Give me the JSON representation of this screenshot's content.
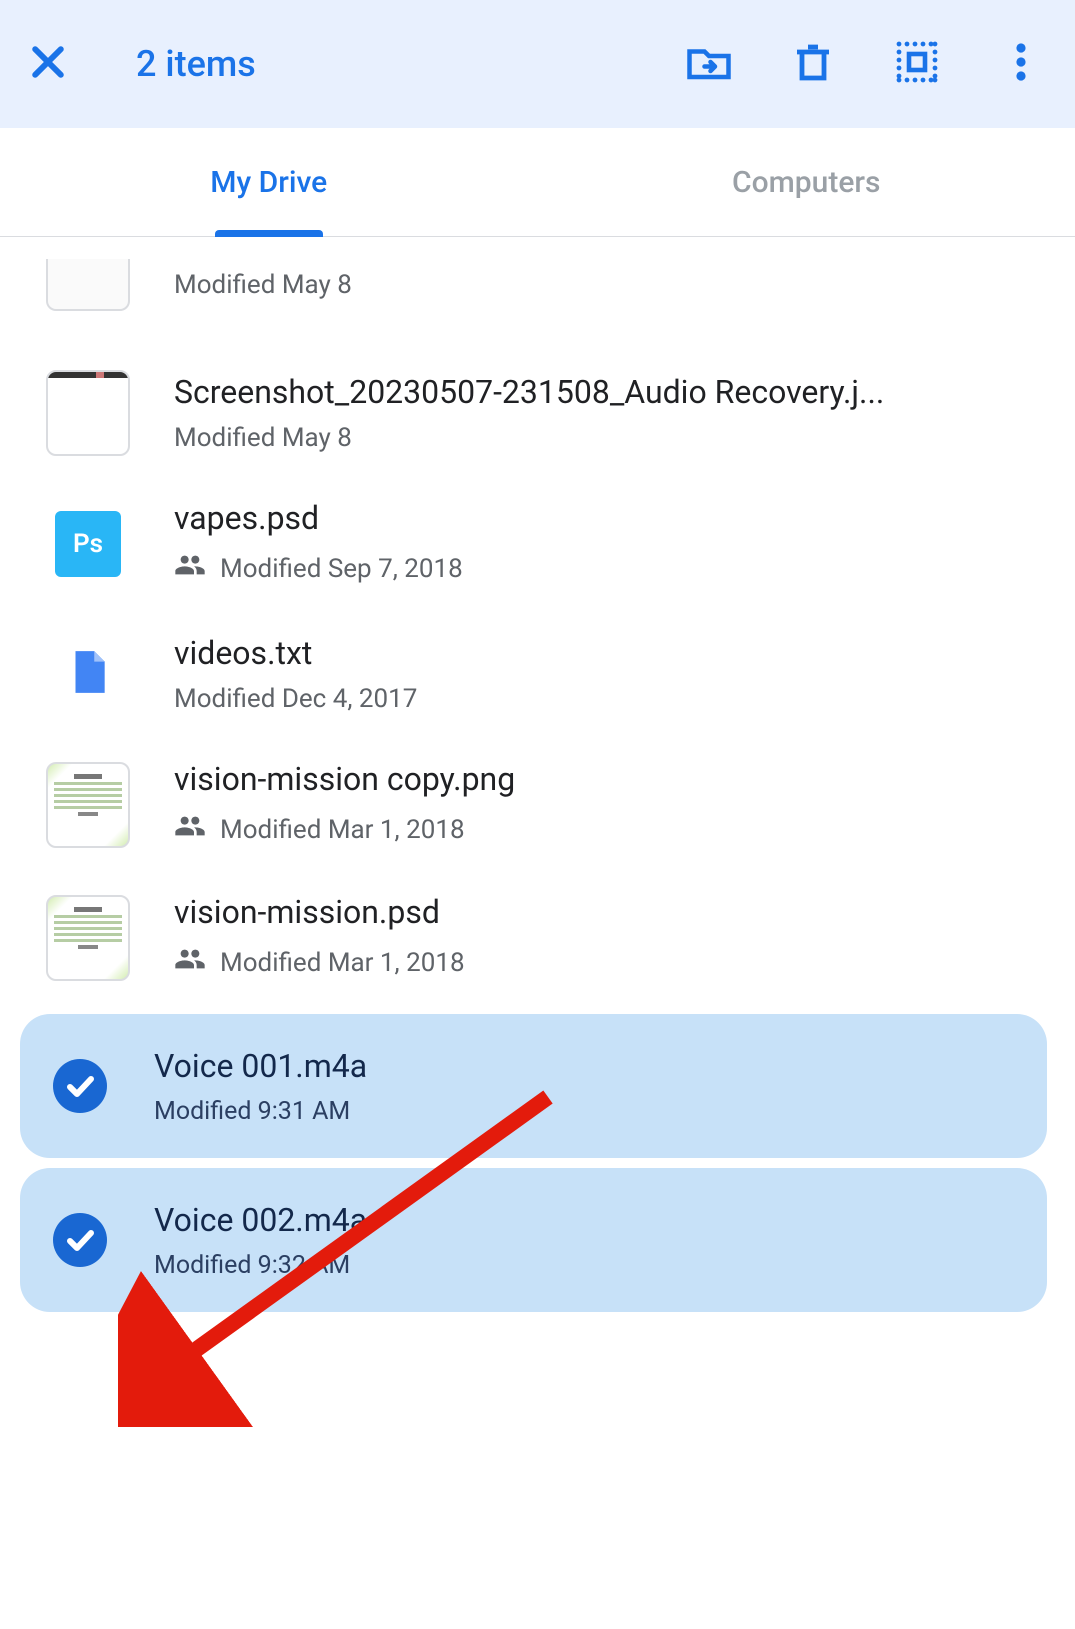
{
  "toolbar": {
    "selection_count": "2 items"
  },
  "tabs": {
    "my_drive": "My Drive",
    "computers": "Computers"
  },
  "files": [
    {
      "name": "",
      "modified": "Modified May 8",
      "shared": false
    },
    {
      "name": "Screenshot_20230507-231508_Audio Recovery.j...",
      "modified": "Modified May 8",
      "shared": false
    },
    {
      "name": "vapes.psd",
      "modified": "Modified Sep 7, 2018",
      "shared": true
    },
    {
      "name": "videos.txt",
      "modified": "Modified Dec 4, 2017",
      "shared": false
    },
    {
      "name": "vision-mission copy.png",
      "modified": "Modified Mar 1, 2018",
      "shared": true
    },
    {
      "name": "vision-mission.psd",
      "modified": "Modified Mar 1, 2018",
      "shared": true
    },
    {
      "name": "Voice 001.m4a",
      "modified": "Modified 9:31 AM",
      "shared": false,
      "selected": true
    },
    {
      "name": "Voice 002.m4a",
      "modified": "Modified 9:32 AM",
      "shared": false,
      "selected": true
    }
  ]
}
